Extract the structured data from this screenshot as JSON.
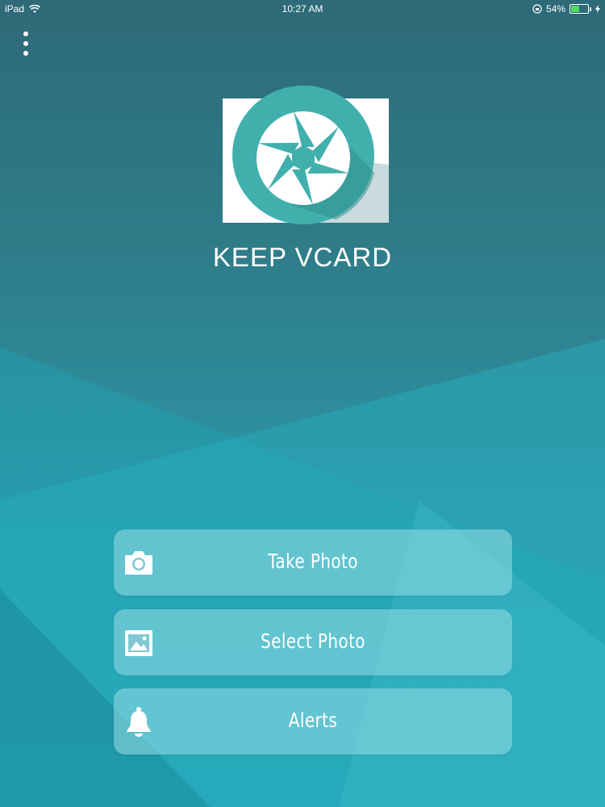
{
  "status_bar": {
    "device": "iPad",
    "time": "10:27 AM",
    "battery": "54%",
    "battery_level": 0.54
  },
  "header": {
    "menu_icon": "more-vertical-icon"
  },
  "logo": {
    "title": "KEEP VCARD",
    "icon": "camera-shutter-icon"
  },
  "actions": [
    {
      "label": "Take Photo",
      "icon": "camera-icon"
    },
    {
      "label": "Select Photo",
      "icon": "gallery-icon"
    },
    {
      "label": "Alerts",
      "icon": "bell-icon"
    }
  ],
  "colors": {
    "accent": "#41b0ad",
    "battery_green": "#4cd964",
    "button_bg": "rgba(150,220,230,0.55)"
  }
}
